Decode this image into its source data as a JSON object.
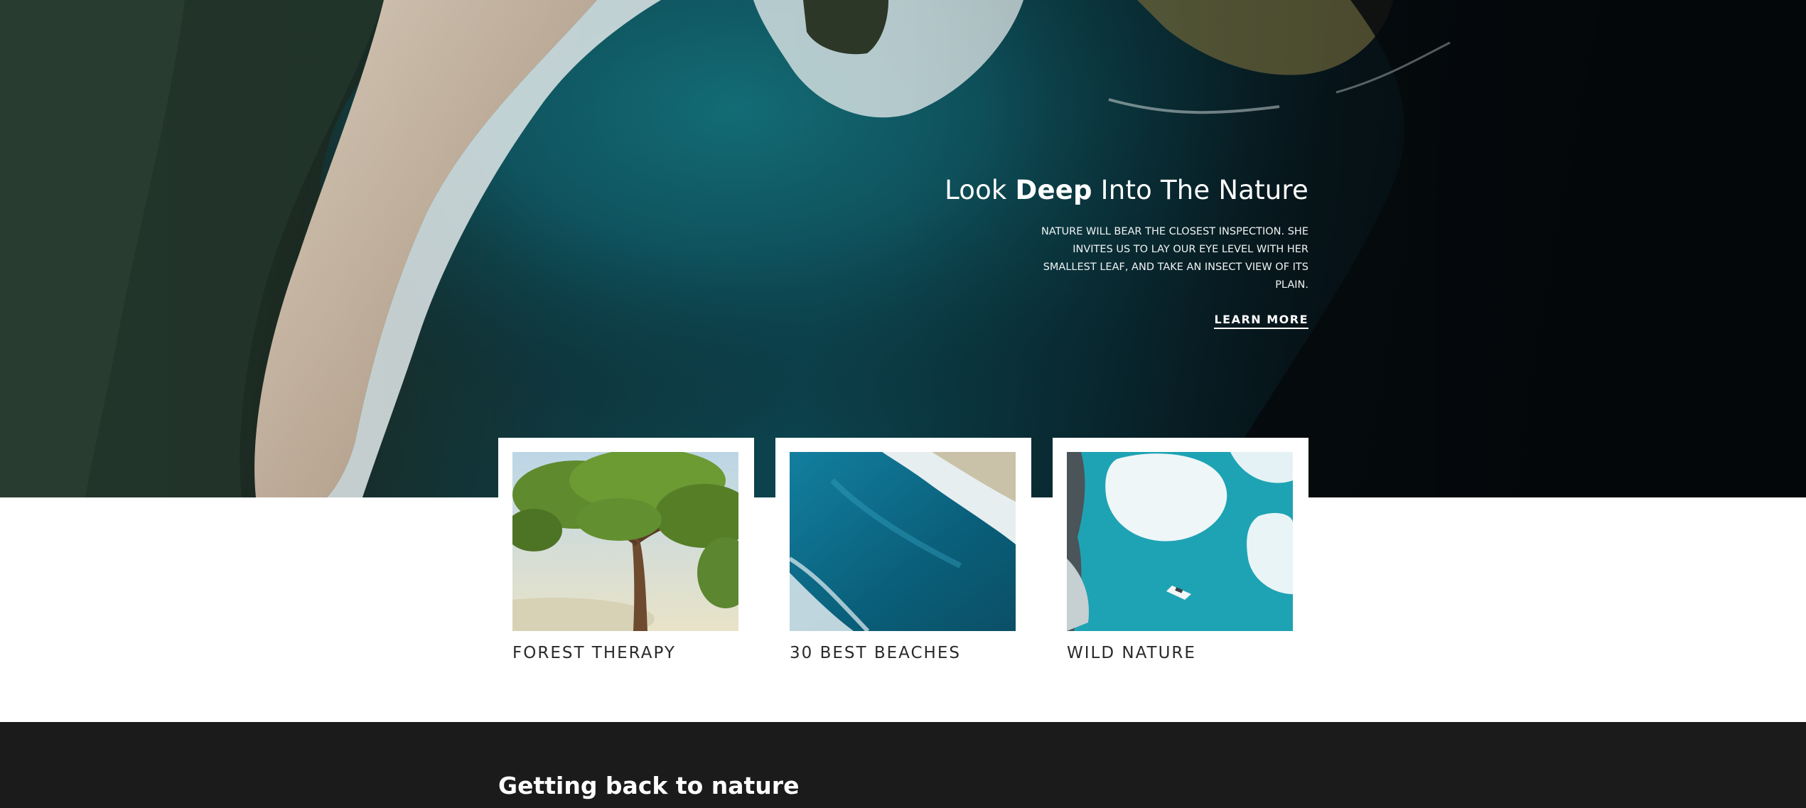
{
  "hero": {
    "title_pre": "Look ",
    "title_bold": "Deep",
    "title_post": " Into The Nature",
    "text": "NATURE WILL BEAR THE CLOSEST INSPECTION. SHE INVITES US TO LAY OUR EYE LEVEL WITH HER SMALLEST LEAF, AND TAKE AN INSECT VIEW OF ITS PLAIN.",
    "cta_label": "LEARN MORE"
  },
  "cards": [
    {
      "title": "FOREST THERAPY",
      "image": "baobab-tree-photo"
    },
    {
      "title": "30 BEST BEACHES",
      "image": "ocean-waves-photo"
    },
    {
      "title": "WILD NATURE",
      "image": "iceberg-boat-photo"
    }
  ],
  "section": {
    "title_pre": "Getting back to ",
    "title_bold": "nature"
  },
  "colors": {
    "dark_section": "#1b1b1c",
    "text_light": "#ffffff",
    "card_text": "#2a2a2a",
    "ocean": "#0d4651"
  }
}
